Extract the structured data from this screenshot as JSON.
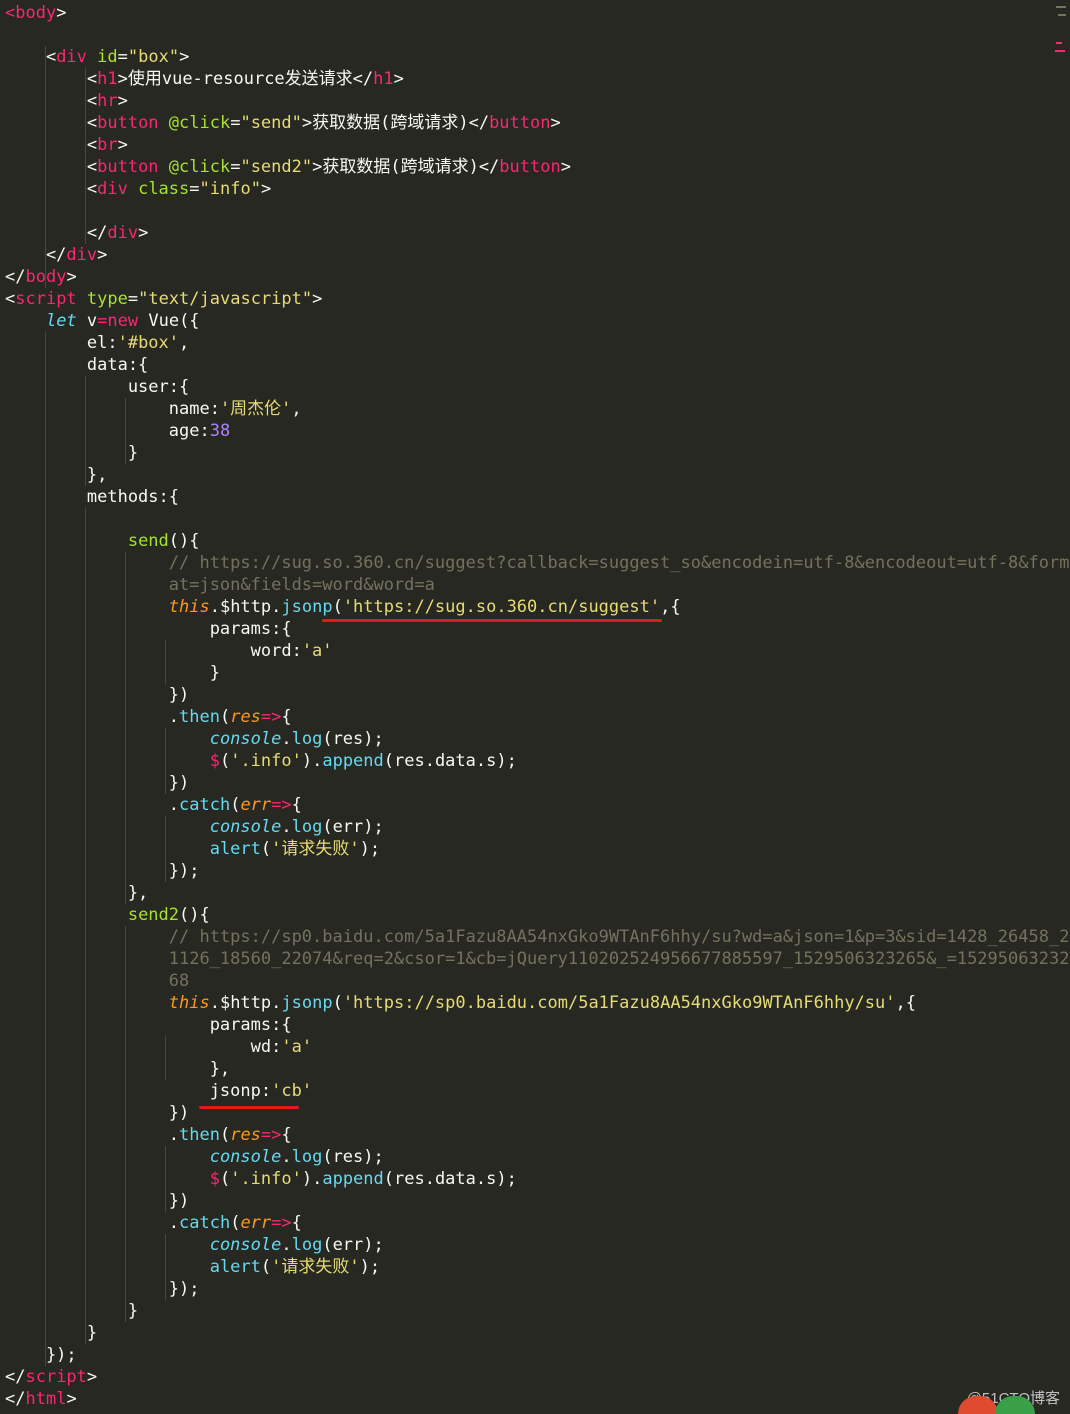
{
  "editor": {
    "theme": {
      "background": "#272822",
      "tag": "#f92672",
      "attr": "#a6e22e",
      "string": "#e6db74",
      "number": "#ae81ff",
      "comment": "#75715e",
      "keyword": "#66d9ef",
      "param": "#fd971f",
      "annotation": "#e01a1a"
    },
    "lines": [
      [
        [
          "tag",
          "<"
        ],
        [
          "kw2",
          "body"
        ],
        [
          "punc",
          ">"
        ]
      ],
      [],
      [
        [
          "punc",
          "    <"
        ],
        [
          "kw2",
          "div"
        ],
        [
          "attr",
          " id"
        ],
        [
          "punc",
          "="
        ],
        [
          "str",
          "\"box\""
        ],
        [
          "punc",
          ">"
        ]
      ],
      [
        [
          "punc",
          "        <"
        ],
        [
          "kw2",
          "h1"
        ],
        [
          "punc",
          ">使用vue-resource发送请求</"
        ],
        [
          "kw2",
          "h1"
        ],
        [
          "punc",
          ">"
        ]
      ],
      [
        [
          "punc",
          "        <"
        ],
        [
          "kw2",
          "hr"
        ],
        [
          "punc",
          ">"
        ]
      ],
      [
        [
          "punc",
          "        <"
        ],
        [
          "kw2",
          "button"
        ],
        [
          "attr",
          " @click"
        ],
        [
          "punc",
          "="
        ],
        [
          "str",
          "\"send\""
        ],
        [
          "punc",
          ">获取数据(跨域请求)</"
        ],
        [
          "kw2",
          "button"
        ],
        [
          "punc",
          ">"
        ]
      ],
      [
        [
          "punc",
          "        <"
        ],
        [
          "kw2",
          "br"
        ],
        [
          "punc",
          ">"
        ]
      ],
      [
        [
          "punc",
          "        <"
        ],
        [
          "kw2",
          "button"
        ],
        [
          "attr",
          " @click"
        ],
        [
          "punc",
          "="
        ],
        [
          "str",
          "\"send2\""
        ],
        [
          "punc",
          ">获取数据(跨域请求)</"
        ],
        [
          "kw2",
          "button"
        ],
        [
          "punc",
          ">"
        ]
      ],
      [
        [
          "punc",
          "        <"
        ],
        [
          "kw2",
          "div"
        ],
        [
          "attr",
          " class"
        ],
        [
          "punc",
          "="
        ],
        [
          "str",
          "\"info\""
        ],
        [
          "punc",
          ">"
        ]
      ],
      [],
      [
        [
          "punc",
          "        </"
        ],
        [
          "kw2",
          "div"
        ],
        [
          "punc",
          ">"
        ]
      ],
      [
        [
          "punc",
          "    </"
        ],
        [
          "kw2",
          "div"
        ],
        [
          "punc",
          ">"
        ]
      ],
      [
        [
          "punc",
          "</"
        ],
        [
          "kw2",
          "body"
        ],
        [
          "punc",
          ">"
        ]
      ],
      [
        [
          "punc",
          "<"
        ],
        [
          "kw2",
          "script"
        ],
        [
          "attr",
          " type"
        ],
        [
          "punc",
          "="
        ],
        [
          "str",
          "\"text/javascript\""
        ],
        [
          "punc",
          ">"
        ]
      ],
      [
        [
          "punc",
          "    "
        ],
        [
          "kw",
          "let"
        ],
        [
          "punc",
          " v"
        ],
        [
          "kw2",
          "="
        ],
        [
          "kw2",
          "new"
        ],
        [
          "punc",
          " Vue({"
        ]
      ],
      [
        [
          "punc",
          "        el:"
        ],
        [
          "str",
          "'#box'"
        ],
        [
          "punc",
          ","
        ]
      ],
      [
        [
          "punc",
          "        data:{"
        ]
      ],
      [
        [
          "punc",
          "            user:{"
        ]
      ],
      [
        [
          "punc",
          "                name:"
        ],
        [
          "str",
          "'周杰伦'"
        ],
        [
          "punc",
          ","
        ]
      ],
      [
        [
          "punc",
          "                age:"
        ],
        [
          "num",
          "38"
        ]
      ],
      [
        [
          "punc",
          "            }"
        ]
      ],
      [
        [
          "punc",
          "        },"
        ]
      ],
      [
        [
          "punc",
          "        methods:{"
        ]
      ],
      [],
      [
        [
          "punc",
          "            "
        ],
        [
          "fn",
          "send"
        ],
        [
          "punc",
          "(){"
        ]
      ],
      [
        [
          "com",
          "                // https://sug.so.360.cn/suggest?callback=suggest_so&encodein=utf-8&encodeout=utf-8&form"
        ]
      ],
      [
        [
          "com",
          "                at=json&fields=word&word=a"
        ]
      ],
      [
        [
          "punc",
          "                "
        ],
        [
          "this",
          "this"
        ],
        [
          "punc",
          ".$http."
        ],
        [
          "fnc",
          "jsonp"
        ],
        [
          "punc",
          "("
        ],
        [
          "str",
          "'https://sug.so.360.cn/suggest'"
        ],
        [
          "punc",
          ",{"
        ]
      ],
      [
        [
          "punc",
          "                    params:{"
        ]
      ],
      [
        [
          "punc",
          "                        word:"
        ],
        [
          "str",
          "'a'"
        ]
      ],
      [
        [
          "punc",
          "                    }"
        ]
      ],
      [
        [
          "punc",
          "                })"
        ]
      ],
      [
        [
          "punc",
          "                ."
        ],
        [
          "fnc",
          "then"
        ],
        [
          "punc",
          "("
        ],
        [
          "prm",
          "res"
        ],
        [
          "kw2",
          "=>"
        ],
        [
          "punc",
          "{"
        ]
      ],
      [
        [
          "punc",
          "                    "
        ],
        [
          "kw",
          "console"
        ],
        [
          "punc",
          "."
        ],
        [
          "fnc",
          "log"
        ],
        [
          "punc",
          "(res);"
        ]
      ],
      [
        [
          "punc",
          "                    "
        ],
        [
          "kw2",
          "$"
        ],
        [
          "punc",
          "("
        ],
        [
          "str",
          "'.info'"
        ],
        [
          "punc",
          ")."
        ],
        [
          "fnc",
          "append"
        ],
        [
          "punc",
          "(res.data.s);"
        ]
      ],
      [
        [
          "punc",
          "                })"
        ]
      ],
      [
        [
          "punc",
          "                ."
        ],
        [
          "fnc",
          "catch"
        ],
        [
          "punc",
          "("
        ],
        [
          "prm",
          "err"
        ],
        [
          "kw2",
          "=>"
        ],
        [
          "punc",
          "{"
        ]
      ],
      [
        [
          "punc",
          "                    "
        ],
        [
          "kw",
          "console"
        ],
        [
          "punc",
          "."
        ],
        [
          "fnc",
          "log"
        ],
        [
          "punc",
          "(err);"
        ]
      ],
      [
        [
          "punc",
          "                    "
        ],
        [
          "fnc",
          "alert"
        ],
        [
          "punc",
          "("
        ],
        [
          "str",
          "'请求失败'"
        ],
        [
          "punc",
          ");"
        ]
      ],
      [
        [
          "punc",
          "                });"
        ]
      ],
      [
        [
          "punc",
          "            },"
        ]
      ],
      [
        [
          "punc",
          "            "
        ],
        [
          "fn",
          "send2"
        ],
        [
          "punc",
          "(){"
        ]
      ],
      [
        [
          "com",
          "                // https://sp0.baidu.com/5a1Fazu8AA54nxGko9WTAnF6hhy/su?wd=a&json=1&p=3&sid=1428_26458_2"
        ]
      ],
      [
        [
          "com",
          "                1126_18560_22074&req=2&csor=1&cb=jQuery110202524956677885597_1529506323265&_=15295063232"
        ]
      ],
      [
        [
          "com",
          "                68"
        ]
      ],
      [
        [
          "punc",
          "                "
        ],
        [
          "this",
          "this"
        ],
        [
          "punc",
          ".$http."
        ],
        [
          "fnc",
          "jsonp"
        ],
        [
          "punc",
          "("
        ],
        [
          "str",
          "'https://sp0.baidu.com/5a1Fazu8AA54nxGko9WTAnF6hhy/su'"
        ],
        [
          "punc",
          ",{"
        ]
      ],
      [
        [
          "punc",
          "                    params:{"
        ]
      ],
      [
        [
          "punc",
          "                        wd:"
        ],
        [
          "str",
          "'a'"
        ]
      ],
      [
        [
          "punc",
          "                    },"
        ]
      ],
      [
        [
          "punc",
          "                    jsonp:"
        ],
        [
          "str",
          "'cb'"
        ]
      ],
      [
        [
          "punc",
          "                })"
        ]
      ],
      [
        [
          "punc",
          "                ."
        ],
        [
          "fnc",
          "then"
        ],
        [
          "punc",
          "("
        ],
        [
          "prm",
          "res"
        ],
        [
          "kw2",
          "=>"
        ],
        [
          "punc",
          "{"
        ]
      ],
      [
        [
          "punc",
          "                    "
        ],
        [
          "kw",
          "console"
        ],
        [
          "punc",
          "."
        ],
        [
          "fnc",
          "log"
        ],
        [
          "punc",
          "(res);"
        ]
      ],
      [
        [
          "punc",
          "                    "
        ],
        [
          "kw2",
          "$"
        ],
        [
          "punc",
          "("
        ],
        [
          "str",
          "'.info'"
        ],
        [
          "punc",
          ")."
        ],
        [
          "fnc",
          "append"
        ],
        [
          "punc",
          "(res.data.s);"
        ]
      ],
      [
        [
          "punc",
          "                })"
        ]
      ],
      [
        [
          "punc",
          "                ."
        ],
        [
          "fnc",
          "catch"
        ],
        [
          "punc",
          "("
        ],
        [
          "prm",
          "err"
        ],
        [
          "kw2",
          "=>"
        ],
        [
          "punc",
          "{"
        ]
      ],
      [
        [
          "punc",
          "                    "
        ],
        [
          "kw",
          "console"
        ],
        [
          "punc",
          "."
        ],
        [
          "fnc",
          "log"
        ],
        [
          "punc",
          "(err);"
        ]
      ],
      [
        [
          "punc",
          "                    "
        ],
        [
          "fnc",
          "alert"
        ],
        [
          "punc",
          "("
        ],
        [
          "str",
          "'请求失败'"
        ],
        [
          "punc",
          ");"
        ]
      ],
      [
        [
          "punc",
          "                });"
        ]
      ],
      [
        [
          "punc",
          "            }"
        ]
      ],
      [
        [
          "punc",
          "        }"
        ]
      ],
      [
        [
          "punc",
          "    });"
        ]
      ],
      [
        [
          "punc",
          "</"
        ],
        [
          "kw2",
          "script"
        ],
        [
          "punc",
          ">"
        ]
      ],
      [
        [
          "punc",
          "</"
        ],
        [
          "kw2",
          "html"
        ],
        [
          "punc",
          ">"
        ]
      ]
    ]
  },
  "watermark": {
    "text": "@51CTO博客"
  }
}
